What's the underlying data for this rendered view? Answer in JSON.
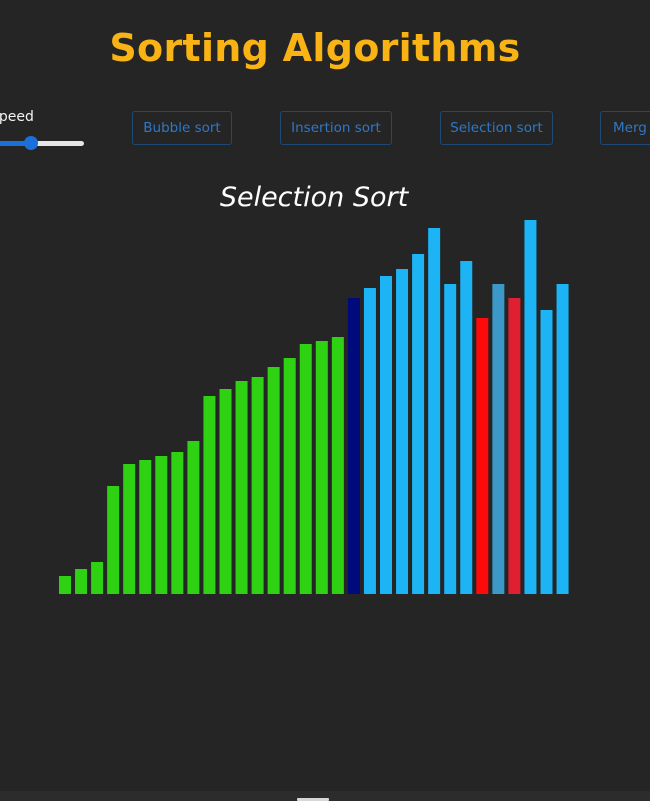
{
  "header": {
    "title": "Sorting Algorithms"
  },
  "controls": {
    "speed_label": "t Speed",
    "speed_value": 0.32,
    "buttons": [
      {
        "label": "Bubble sort"
      },
      {
        "label": "Insertion sort"
      },
      {
        "label": "Selection sort"
      },
      {
        "label": "Merg"
      }
    ]
  },
  "colors": {
    "title": "#f9b315",
    "sorted": "#2fd212",
    "unsorted": "#1db4f5",
    "current_min": "#000a7a",
    "compare_red": "#ff0a0a",
    "compare_dark_red": "#e02030",
    "compare_blue": "#3b98c9",
    "button_text": "#2f78c6",
    "button_border": "#1f4a73"
  },
  "visualization": {
    "title": "Selection Sort",
    "bars": [
      {
        "value": 18,
        "state": "sorted"
      },
      {
        "value": 25,
        "state": "sorted"
      },
      {
        "value": 32,
        "state": "sorted"
      },
      {
        "value": 108,
        "state": "sorted"
      },
      {
        "value": 130,
        "state": "sorted"
      },
      {
        "value": 134,
        "state": "sorted"
      },
      {
        "value": 138,
        "state": "sorted"
      },
      {
        "value": 142,
        "state": "sorted"
      },
      {
        "value": 153,
        "state": "sorted"
      },
      {
        "value": 198,
        "state": "sorted"
      },
      {
        "value": 205,
        "state": "sorted"
      },
      {
        "value": 213,
        "state": "sorted"
      },
      {
        "value": 217,
        "state": "sorted"
      },
      {
        "value": 227,
        "state": "sorted"
      },
      {
        "value": 236,
        "state": "sorted"
      },
      {
        "value": 250,
        "state": "sorted"
      },
      {
        "value": 253,
        "state": "sorted"
      },
      {
        "value": 257,
        "state": "sorted"
      },
      {
        "value": 296,
        "state": "current_min"
      },
      {
        "value": 306,
        "state": "unsorted"
      },
      {
        "value": 318,
        "state": "unsorted"
      },
      {
        "value": 325,
        "state": "unsorted"
      },
      {
        "value": 340,
        "state": "unsorted"
      },
      {
        "value": 366,
        "state": "unsorted"
      },
      {
        "value": 310,
        "state": "unsorted"
      },
      {
        "value": 333,
        "state": "unsorted"
      },
      {
        "value": 276,
        "state": "compare_red"
      },
      {
        "value": 310,
        "state": "compare_blue"
      },
      {
        "value": 296,
        "state": "compare_dark_red"
      },
      {
        "value": 374,
        "state": "unsorted"
      },
      {
        "value": 284,
        "state": "unsorted"
      },
      {
        "value": 310,
        "state": "unsorted"
      }
    ]
  }
}
